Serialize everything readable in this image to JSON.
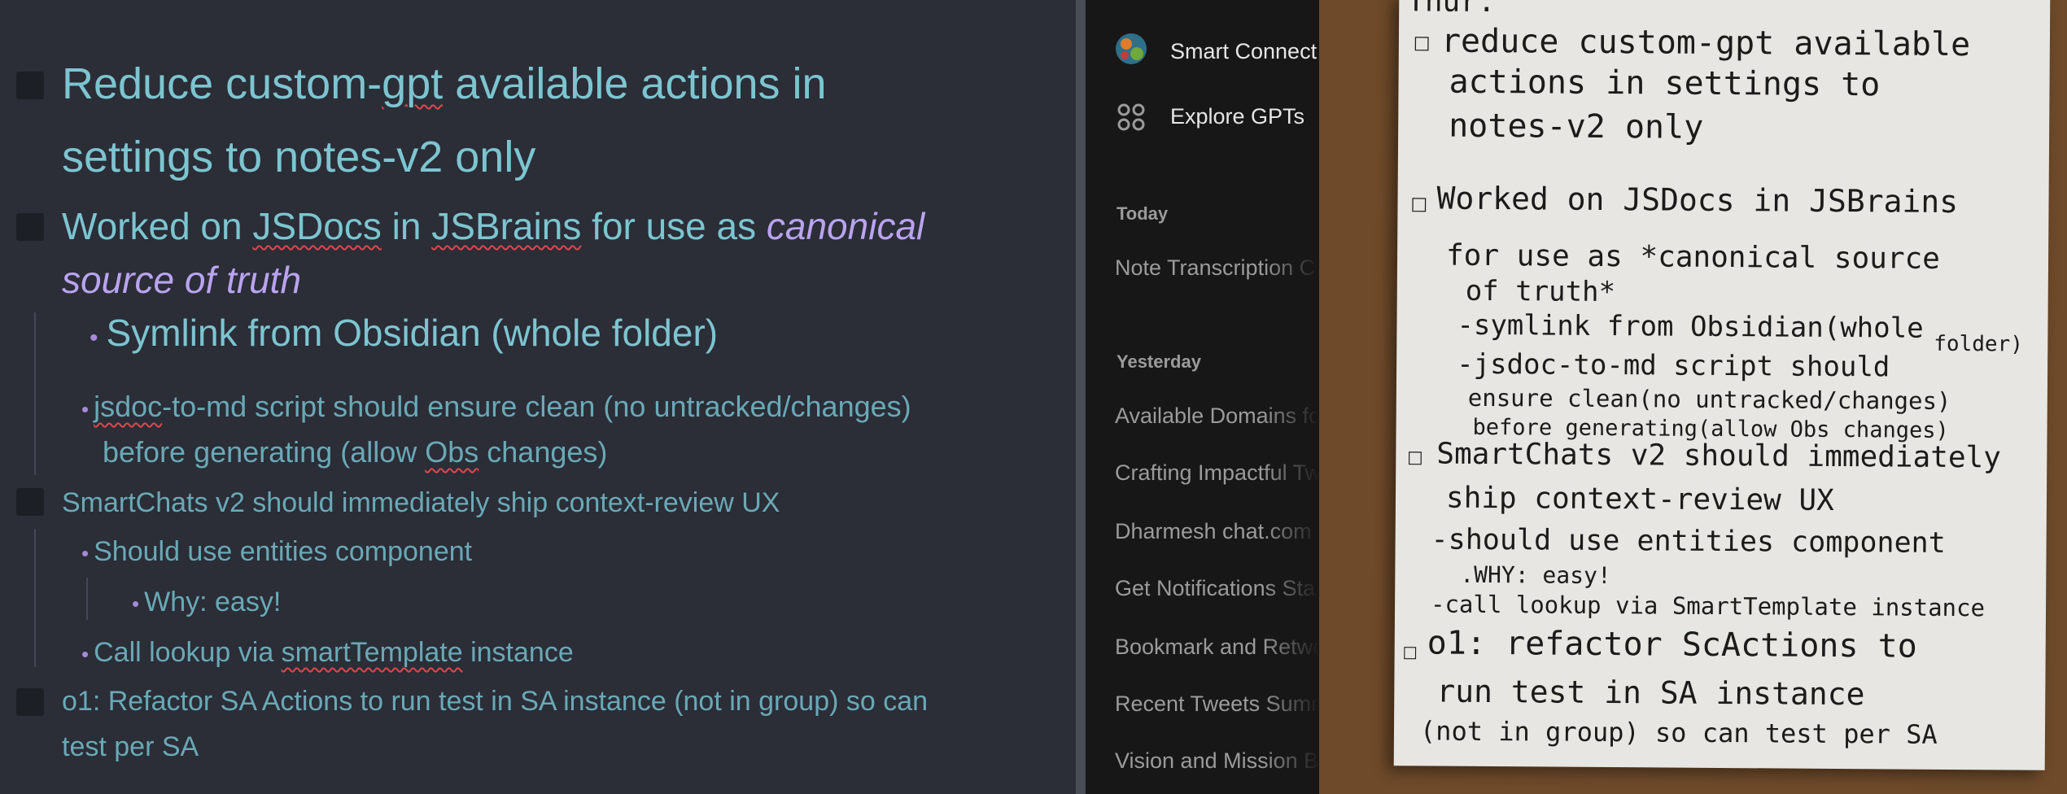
{
  "editor": {
    "task1": {
      "line1_pre": "Reduce custom-",
      "line1_err": "gpt",
      "line1_post": " available actions in",
      "line2": "settings to notes-v2 only"
    },
    "task2": {
      "a": "Worked on ",
      "err1": "JSDocs",
      "b": " in ",
      "err2": "JSBrains",
      "c": " for use as ",
      "italic1": "canonical",
      "italic2": "source of truth",
      "sub1": "Symlink from Obsidian (whole folder)",
      "sub2_err": "jsdoc",
      "sub2_rest": "-to-md script should ensure clean (no untracked/changes)",
      "sub2_line2_pre": "before generating (allow ",
      "sub2_line2_err": "Obs",
      "sub2_line2_post": " changes)"
    },
    "task3": {
      "title": "SmartChats v2 should immediately ship context-review UX",
      "sub1": "Should use entities component",
      "sub1a": "Why: easy!",
      "sub2_pre": "Call lookup via ",
      "sub2_err": "smartTemplate",
      "sub2_post": " instance"
    },
    "task4": {
      "line1": "o1: Refactor SA Actions to run test in SA instance (not in group) so can",
      "line2": "test per SA"
    },
    "bullet": "•"
  },
  "sidebar": {
    "gpts": [
      {
        "label": "Smart Connect",
        "icon": "smart-connect-avatar-icon"
      },
      {
        "label": "Explore GPTs",
        "icon": "grid-dots-icon"
      }
    ],
    "sections": [
      {
        "heading": "Today",
        "items": [
          "Note Transcription C"
        ]
      },
      {
        "heading": "Yesterday",
        "items": [
          "Available Domains fo",
          "Crafting Impactful Tw",
          "Dharmesh chat.com",
          "Get Notifications Sta",
          "Bookmark and Retwe",
          "Recent Tweets Summ",
          "Vision and Mission B"
        ]
      }
    ]
  },
  "photo": {
    "lines": [
      "Thur.",
      "reduce custom-gpt available",
      "actions in settings to",
      "notes-v2 only",
      "Worked on JSDocs in JSBrains",
      "for use as *canonical source",
      "of truth*",
      "-symlink from Obsidian(whole",
      "folder)",
      "-jsdoc-to-md script should",
      "ensure clean(no untracked/changes)",
      "before generating(allow Obs changes)",
      "SmartChats v2 should immediately",
      "ship context-review UX",
      "-should use entities component",
      ".WHY: easy!",
      "-call lookup via SmartTemplate instance",
      "o1: refactor ScActions to",
      "run test in SA instance",
      "(not in group) so can test per SA"
    ]
  }
}
